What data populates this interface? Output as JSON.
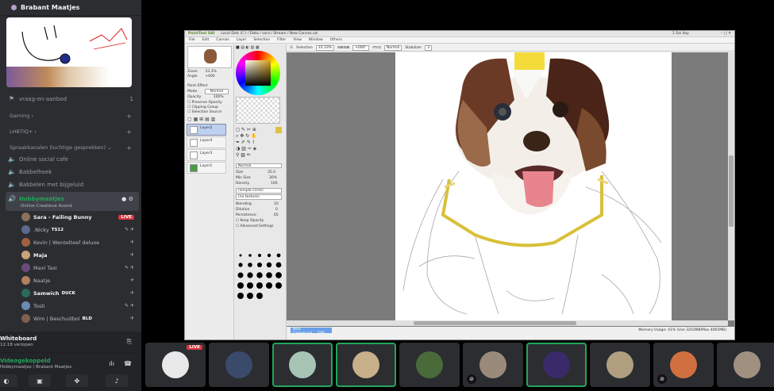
{
  "server": {
    "name": "Brabant Maatjes"
  },
  "channels": {
    "vraag": "vraag-en-aanbod",
    "vraag_count": "1",
    "category_gaming": "Gaming",
    "category_lhbtiq": "LHBTIQ+",
    "category_voice": "Spraakkanalen (luchtige gesprekken)",
    "voice": [
      "Online social cafe",
      "Babbelhoek",
      "Babbelen met bijgeluid"
    ],
    "active": "Hobbymaatjes",
    "active_sub": "Online Creatieve Avond"
  },
  "voice_users": [
    {
      "name": "Sara - Failing Bunny",
      "tag": "LIVE",
      "bright": true,
      "color": "#8a6f5a"
    },
    {
      "name": ".Nicky",
      "badge": "TS12",
      "bright": false,
      "color": "#5b6b8a"
    },
    {
      "name": "Kevin | Wentelteef deluxe",
      "bright": false,
      "color": "#a06040"
    },
    {
      "name": "Maja",
      "bright": true,
      "color": "#c9a27a"
    },
    {
      "name": "Maxi Taxi",
      "bright": false,
      "color": "#6a4a7a"
    },
    {
      "name": "Naatje",
      "bright": false,
      "color": "#b08060"
    },
    {
      "name": "Samwich",
      "badge": "DUCK",
      "bright": true,
      "color": "#2a6a5a"
    },
    {
      "name": "Tosti",
      "bright": false,
      "color": "#6a8ab0"
    },
    {
      "name": "Wim | Beschuitbol",
      "badge": "BLD",
      "bright": false,
      "color": "#806050"
    }
  ],
  "whiteboard": {
    "title": "Whiteboard",
    "sub": "12:18 verlopen"
  },
  "voice_connected": {
    "title": "Videogekoppeld",
    "sub": "Hobbymaatjes / Brabant Maatjes"
  },
  "app": {
    "title": "PaintTool SAI",
    "path": "Local Disk (C:) / Data / sara / Stream / New Canvas.sai",
    "right_title": "1 Sai day",
    "menu": [
      "File",
      "Edit",
      "Canvas",
      "Layer",
      "Selection",
      "Filter",
      "View",
      "Window",
      "Others"
    ],
    "selection": "Selection",
    "zoom": "33.33%",
    "rotation": "+000°",
    "blend": "Normal",
    "stabilizer_label": "Stabilizer",
    "stabilizer": "3",
    "canvas_tab": "New Canvas.sai",
    "canvas_tab_zoom": "33%",
    "memory": "Memory Usage: 41% (Use 3203MB/Max 4065MB)",
    "zoom_label": "Zoom",
    "zoom_val": "33.3%",
    "angle_label": "Angle",
    "angle_val": "+000",
    "paint_effect": "Paint Effect",
    "mode_label": "Mode",
    "mode_val": "Normal",
    "opacity_label": "Opacity",
    "opacity_val": "100%",
    "preserve": "Preserve Opacity",
    "clipping": "Clipping Group",
    "source": "Selection Source",
    "layers": [
      "Layer2",
      "Layer4",
      "Layer3",
      "Layer1"
    ],
    "tool_mode": "Normal",
    "size_label": "Size",
    "size_val": "35.0",
    "min_size_label": "Min Size",
    "min_size_val": "30%",
    "density_label": "Density",
    "density_val": "100",
    "shape_label": "(simple circle)",
    "texture_label": "(no texture)",
    "blending_label": "Blending",
    "blending_val": "10",
    "dilution_label": "Dilution",
    "dilution_val": "0",
    "persistence_label": "Persistence",
    "persistence_val": "65",
    "keep_opacity": "Keep Opacity",
    "advanced": "Advanced Settings"
  },
  "video_tiles": [
    {
      "name": "sara-tile",
      "color": "#e8e8e8",
      "live": "LIVE",
      "speaking": false
    },
    {
      "name": "nicky-tile",
      "color": "#3a4a6a",
      "speaking": false
    },
    {
      "name": "kevin-tile",
      "color": "#a7c4b4",
      "speaking": true
    },
    {
      "name": "maja-tile",
      "color": "#c7b08a",
      "speaking": true
    },
    {
      "name": "maxi-tile",
      "color": "#4a6a3a",
      "speaking": false
    },
    {
      "name": "naatje-tile",
      "color": "#9a8a7a",
      "speaking": false,
      "muted": true
    },
    {
      "name": "samwich-tile",
      "color": "#3a2a6a",
      "speaking": true
    },
    {
      "name": "tosti-tile",
      "color": "#b0a080",
      "speaking": false
    },
    {
      "name": "wim-tile",
      "color": "#d07040",
      "speaking": false,
      "muted": true
    },
    {
      "name": "extra-tile",
      "color": "#a09080",
      "speaking": false
    }
  ]
}
